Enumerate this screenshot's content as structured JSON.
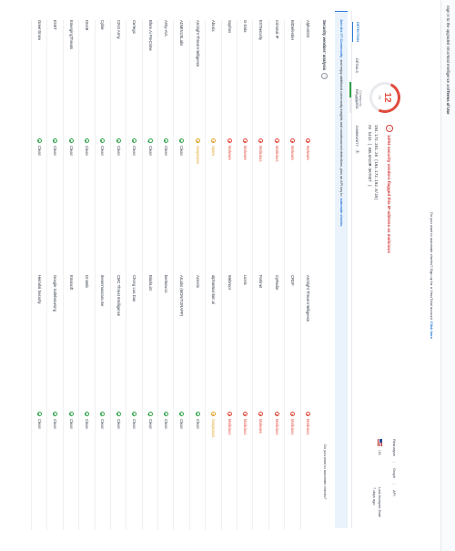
{
  "topbar": {
    "text_a": "Sign in to the upgraded VirusTotal Intelligence and ",
    "text_b": "Terms of Use"
  },
  "notice": {
    "text": "Do you want to automate checks? Sign up for a VirusTotal account",
    "link": "Click here"
  },
  "score": {
    "value": "12",
    "denom": "/94",
    "community_label": "Community Score"
  },
  "alert": {
    "text": "12/94 security vendors flagged this IP address as malicious"
  },
  "ip": {
    "line1": "194.172.201.20 (194.172.192.0/20)",
    "line2": "AS 5432 ( BELGACOM-SKYNET )"
  },
  "meta": {
    "reanalyze": "Reanalyze",
    "graph": "Graph",
    "api": "API",
    "country": "US",
    "last_analysis_label": "Last Analysis Date",
    "last_analysis_value": "7 days ago"
  },
  "tabs": [
    {
      "label": "DETECTION"
    },
    {
      "label": "DETAILS"
    },
    {
      "label": "RELATIONS"
    },
    {
      "label": "COMMUNITY",
      "count": "2"
    }
  ],
  "banner": {
    "link": "Join the VT Community",
    "text": " and enjoy additional community insights and crowdsourced detections, plus an API key to ",
    "link2": "automate checks."
  },
  "section": {
    "title": "Security vendors' analysis",
    "auto": "Do you want to automate checks?"
  },
  "vendors": [
    {
      "name": "AlphaSOC",
      "verdict": "Malware",
      "status": "mal",
      "name2": "ArcSight Threat Intelligence",
      "verdict2": "Malicious",
      "status2": "mal"
    },
    {
      "name": "BitDefender",
      "verdict": "Malware",
      "status": "mal",
      "name2": "CRDF",
      "verdict2": "Malicious",
      "status2": "mal"
    },
    {
      "name": "Criminal IP",
      "verdict": "Malicious",
      "status": "mal",
      "name2": "CyRadar",
      "verdict2": "Malicious",
      "status2": "mal"
    },
    {
      "name": "ESTsecurity",
      "verdict": "Malicious",
      "status": "mal",
      "name2": "Fortinet",
      "verdict2": "Malware",
      "status2": "mal"
    },
    {
      "name": "G-Data",
      "verdict": "Malware",
      "status": "mal",
      "name2": "Lionic",
      "verdict2": "Malicious",
      "status2": "mal"
    },
    {
      "name": "Sophos",
      "verdict": "Malware",
      "status": "mal",
      "name2": "Webroot",
      "verdict2": "Malicious",
      "status2": "mal"
    },
    {
      "name": "Abusix",
      "verdict": "Spam",
      "status": "sus",
      "name2": "alphaMountain.ai",
      "verdict2": "Suspicious",
      "status2": "sus"
    },
    {
      "name": "ArcSight Threat Intelligence",
      "verdict": "Suspicious",
      "status": "sus",
      "name2": "Acronis",
      "verdict2": "Clean",
      "status2": "cln"
    },
    {
      "name": "ADMINUSLabs",
      "verdict": "Clean",
      "status": "cln",
      "name2": "AILabs (MONITORAPP)",
      "verdict2": "Clean",
      "status2": "cln"
    },
    {
      "name": "Antiy-AVL",
      "verdict": "Clean",
      "status": "cln",
      "name2": "benkow.cc",
      "verdict2": "Clean",
      "status2": "cln"
    },
    {
      "name": "Bfore.Ai PreCrime",
      "verdict": "Clean",
      "status": "cln",
      "name2": "BlockList",
      "verdict2": "Clean",
      "status2": "cln"
    },
    {
      "name": "Certego",
      "verdict": "Clean",
      "status": "cln",
      "name2": "Chong Lua Dao",
      "verdict2": "Clean",
      "status2": "cln"
    },
    {
      "name": "CINS Army",
      "verdict": "Clean",
      "status": "cln",
      "name2": "CMC Threat Intelligence",
      "verdict2": "Clean",
      "status2": "cln"
    },
    {
      "name": "Cyble",
      "verdict": "Clean",
      "status": "cln",
      "name2": "desenmascara.me",
      "verdict2": "Clean",
      "status2": "cln"
    },
    {
      "name": "DNS8",
      "verdict": "Clean",
      "status": "cln",
      "name2": "Dr.Web",
      "verdict2": "Clean",
      "status2": "cln"
    },
    {
      "name": "EmergingThreats",
      "verdict": "Clean",
      "status": "cln",
      "name2": "Emsisoft",
      "verdict2": "Clean",
      "status2": "cln"
    },
    {
      "name": "ESET",
      "verdict": "Clean",
      "status": "cln",
      "name2": "Google Safebrowsing",
      "verdict2": "Clean",
      "status2": "cln"
    },
    {
      "name": "GreenSnow",
      "verdict": "Clean",
      "status": "cln",
      "name2": "Heimdal Security",
      "verdict2": "Clean",
      "status2": "cln"
    }
  ]
}
